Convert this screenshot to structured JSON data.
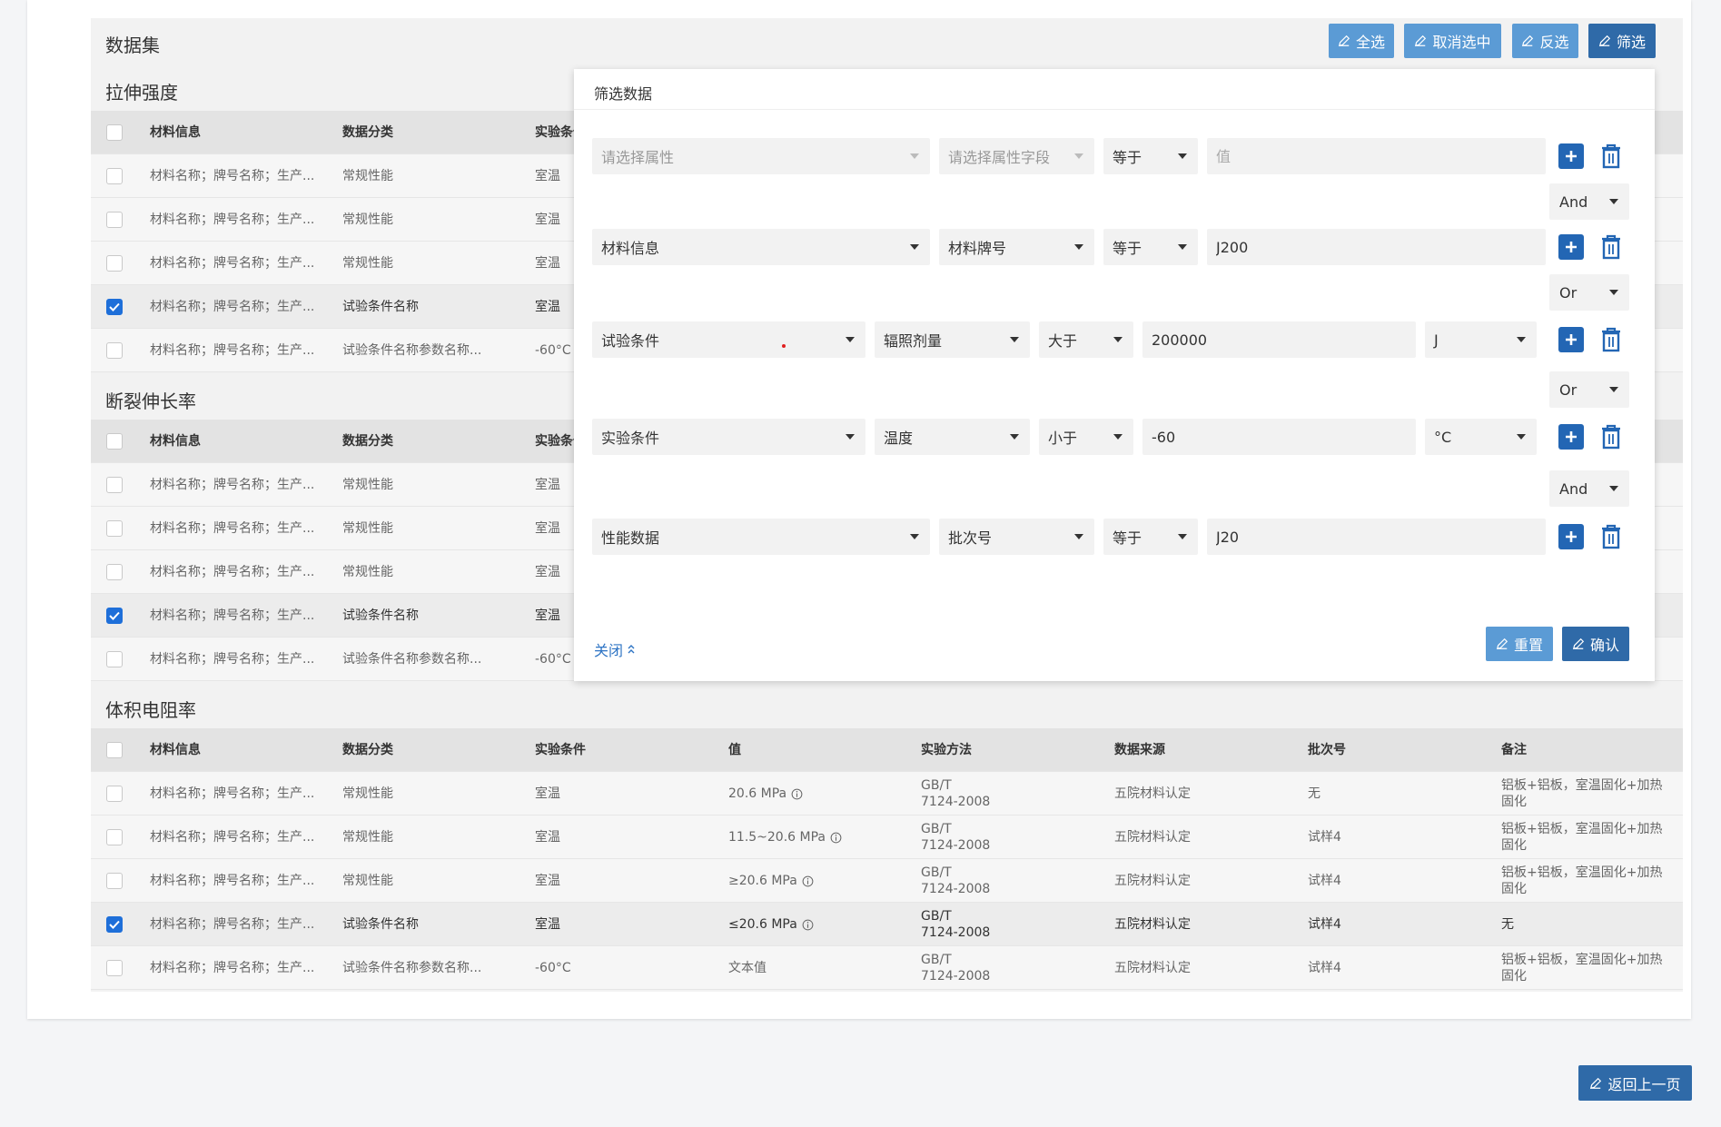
{
  "dataset": {
    "title": "数据集",
    "toolbar": {
      "select_all": "全选",
      "deselect": "取消选中",
      "invert": "反选",
      "filter": "筛选"
    }
  },
  "columns": [
    "材料信息",
    "数据分类",
    "实验条件",
    "值",
    "实验方法",
    "数据来源",
    "批次号",
    "备注"
  ],
  "sections": [
    {
      "title": "拉伸强度",
      "rows": [
        {
          "checked": false,
          "material": "材料名称；牌号名称；生产...",
          "category": "常规性能",
          "condition": "室温"
        },
        {
          "checked": false,
          "material": "材料名称；牌号名称；生产...",
          "category": "常规性能",
          "condition": "室温"
        },
        {
          "checked": false,
          "material": "材料名称；牌号名称；生产...",
          "category": "常规性能",
          "condition": "室温"
        },
        {
          "checked": true,
          "material": "材料名称；牌号名称；生产...",
          "category": "试验条件名称",
          "condition": "室温"
        },
        {
          "checked": false,
          "material": "材料名称；牌号名称；生产...",
          "category": "试验条件名称参数名称...",
          "condition": "-60°C"
        }
      ]
    },
    {
      "title": "断裂伸长率",
      "rows": [
        {
          "checked": false,
          "material": "材料名称；牌号名称；生产...",
          "category": "常规性能",
          "condition": "室温"
        },
        {
          "checked": false,
          "material": "材料名称；牌号名称；生产...",
          "category": "常规性能",
          "condition": "室温"
        },
        {
          "checked": false,
          "material": "材料名称；牌号名称；生产...",
          "category": "常规性能",
          "condition": "室温"
        },
        {
          "checked": true,
          "material": "材料名称；牌号名称；生产...",
          "category": "试验条件名称",
          "condition": "室温"
        },
        {
          "checked": false,
          "material": "材料名称；牌号名称；生产...",
          "category": "试验条件名称参数名称...",
          "condition": "-60°C"
        }
      ]
    },
    {
      "title": "体积电阻率",
      "rows": [
        {
          "checked": false,
          "material": "材料名称；牌号名称；生产...",
          "category": "常规性能",
          "condition": "室温",
          "value": "20.6 MPa",
          "method_line1": "GB/T",
          "method_line2": "7124-2008",
          "source": "五院材料认定",
          "batch": "无",
          "remark_line1": "铝板+铝板，室温固化+加热",
          "remark_line2": "固化"
        },
        {
          "checked": false,
          "material": "材料名称；牌号名称；生产...",
          "category": "常规性能",
          "condition": "室温",
          "value": "11.5~20.6 MPa",
          "method_line1": "GB/T",
          "method_line2": "7124-2008",
          "source": "五院材料认定",
          "batch": "试样4",
          "remark_line1": "铝板+铝板，室温固化+加热",
          "remark_line2": "固化"
        },
        {
          "checked": false,
          "material": "材料名称；牌号名称；生产...",
          "category": "常规性能",
          "condition": "室温",
          "value": "≥20.6 MPa",
          "method_line1": "GB/T",
          "method_line2": "7124-2008",
          "source": "五院材料认定",
          "batch": "试样4",
          "remark_line1": "铝板+铝板，室温固化+加热",
          "remark_line2": "固化"
        },
        {
          "checked": true,
          "material": "材料名称；牌号名称；生产...",
          "category": "试验条件名称",
          "condition": "室温",
          "value": "≤20.6 MPa",
          "method_line1": "GB/T",
          "method_line2": "7124-2008",
          "source": "五院材料认定",
          "batch": "试样4",
          "remark_line1": "无",
          "remark_line2": ""
        },
        {
          "checked": false,
          "material": "材料名称；牌号名称；生产...",
          "category": "试验条件名称参数名称...",
          "condition": "-60°C",
          "value": "文本值",
          "method_line1": "GB/T",
          "method_line2": "7124-2008",
          "source": "五院材料认定",
          "batch": "试样4",
          "remark_line1": "铝板+铝板，室温固化+加热",
          "remark_line2": "固化"
        }
      ]
    }
  ],
  "filter": {
    "title": "筛选数据",
    "row1": {
      "attr_placeholder": "请选择属性",
      "field_placeholder": "请选择属性字段",
      "op": "等于",
      "value_placeholder": "值"
    },
    "logic1": "And",
    "row2": {
      "attr": "材料信息",
      "field": "材料牌号",
      "op": "等于",
      "value": "J200"
    },
    "logic2": "Or",
    "row3": {
      "attr": "试验条件",
      "field": "辐照剂量",
      "op": "大于",
      "value": "200000",
      "unit": "J"
    },
    "logic3": "Or",
    "row4": {
      "attr": "实验条件",
      "field": "温度",
      "op": "小于",
      "value": "-60",
      "unit": "°C"
    },
    "logic4": "And",
    "row5": {
      "attr": "性能数据",
      "field": "批次号",
      "op": "等于",
      "value": "J20"
    },
    "close": "关闭",
    "reset": "重置",
    "confirm": "确认"
  },
  "back_button": "返回上一页",
  "colors": {
    "accent_dark": "#2f6aa8",
    "accent_light": "#5b9bd5",
    "checkbox": "#1e6fd9"
  }
}
